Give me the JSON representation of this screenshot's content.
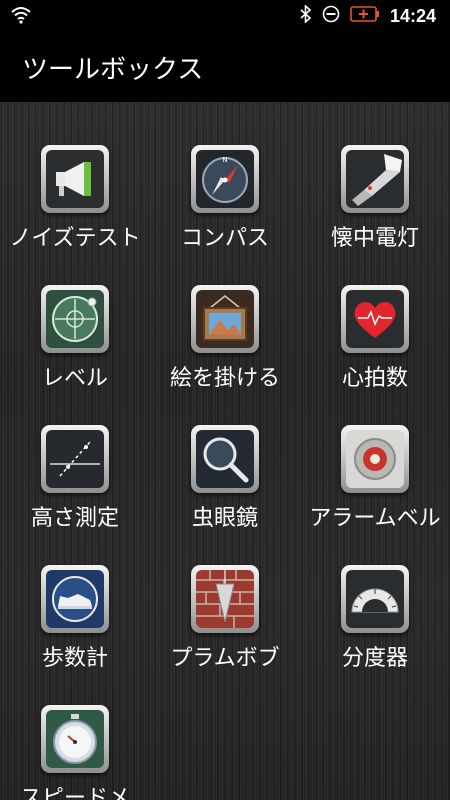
{
  "status_bar": {
    "time": "14:24"
  },
  "app_bar": {
    "title": "ツールボックス"
  },
  "tools": [
    {
      "label": "ノイズテスト",
      "icon": "megaphone-icon"
    },
    {
      "label": "コンパス",
      "icon": "compass-icon"
    },
    {
      "label": "懐中電灯",
      "icon": "flashlight-icon"
    },
    {
      "label": "レベル",
      "icon": "bubble-level-icon"
    },
    {
      "label": "絵を掛ける",
      "icon": "picture-frame-icon"
    },
    {
      "label": "心拍数",
      "icon": "heart-rate-icon"
    },
    {
      "label": "高さ測定",
      "icon": "height-measure-icon"
    },
    {
      "label": "虫眼鏡",
      "icon": "magnifier-icon"
    },
    {
      "label": "アラームベル",
      "icon": "alarm-bell-icon"
    },
    {
      "label": "歩数計",
      "icon": "sneaker-icon"
    },
    {
      "label": "プラムボブ",
      "icon": "plumb-bob-icon"
    },
    {
      "label": "分度器",
      "icon": "protractor-icon"
    },
    {
      "label": "スピードメ",
      "icon": "stopwatch-icon"
    }
  ]
}
